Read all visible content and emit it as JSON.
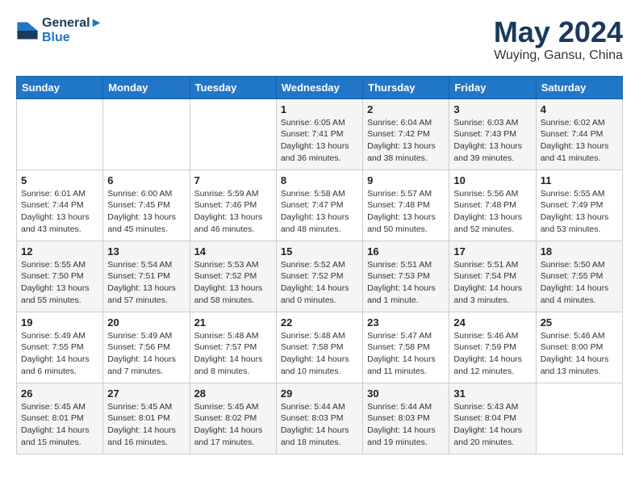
{
  "logo": {
    "line1": "General",
    "line2": "Blue"
  },
  "title": "May 2024",
  "subtitle": "Wuying, Gansu, China",
  "days_of_week": [
    "Sunday",
    "Monday",
    "Tuesday",
    "Wednesday",
    "Thursday",
    "Friday",
    "Saturday"
  ],
  "weeks": [
    [
      {
        "day": "",
        "sunrise": "",
        "sunset": "",
        "daylight": ""
      },
      {
        "day": "",
        "sunrise": "",
        "sunset": "",
        "daylight": ""
      },
      {
        "day": "",
        "sunrise": "",
        "sunset": "",
        "daylight": ""
      },
      {
        "day": "1",
        "sunrise": "Sunrise: 6:05 AM",
        "sunset": "Sunset: 7:41 PM",
        "daylight": "Daylight: 13 hours and 36 minutes."
      },
      {
        "day": "2",
        "sunrise": "Sunrise: 6:04 AM",
        "sunset": "Sunset: 7:42 PM",
        "daylight": "Daylight: 13 hours and 38 minutes."
      },
      {
        "day": "3",
        "sunrise": "Sunrise: 6:03 AM",
        "sunset": "Sunset: 7:43 PM",
        "daylight": "Daylight: 13 hours and 39 minutes."
      },
      {
        "day": "4",
        "sunrise": "Sunrise: 6:02 AM",
        "sunset": "Sunset: 7:44 PM",
        "daylight": "Daylight: 13 hours and 41 minutes."
      }
    ],
    [
      {
        "day": "5",
        "sunrise": "Sunrise: 6:01 AM",
        "sunset": "Sunset: 7:44 PM",
        "daylight": "Daylight: 13 hours and 43 minutes."
      },
      {
        "day": "6",
        "sunrise": "Sunrise: 6:00 AM",
        "sunset": "Sunset: 7:45 PM",
        "daylight": "Daylight: 13 hours and 45 minutes."
      },
      {
        "day": "7",
        "sunrise": "Sunrise: 5:59 AM",
        "sunset": "Sunset: 7:46 PM",
        "daylight": "Daylight: 13 hours and 46 minutes."
      },
      {
        "day": "8",
        "sunrise": "Sunrise: 5:58 AM",
        "sunset": "Sunset: 7:47 PM",
        "daylight": "Daylight: 13 hours and 48 minutes."
      },
      {
        "day": "9",
        "sunrise": "Sunrise: 5:57 AM",
        "sunset": "Sunset: 7:48 PM",
        "daylight": "Daylight: 13 hours and 50 minutes."
      },
      {
        "day": "10",
        "sunrise": "Sunrise: 5:56 AM",
        "sunset": "Sunset: 7:48 PM",
        "daylight": "Daylight: 13 hours and 52 minutes."
      },
      {
        "day": "11",
        "sunrise": "Sunrise: 5:55 AM",
        "sunset": "Sunset: 7:49 PM",
        "daylight": "Daylight: 13 hours and 53 minutes."
      }
    ],
    [
      {
        "day": "12",
        "sunrise": "Sunrise: 5:55 AM",
        "sunset": "Sunset: 7:50 PM",
        "daylight": "Daylight: 13 hours and 55 minutes."
      },
      {
        "day": "13",
        "sunrise": "Sunrise: 5:54 AM",
        "sunset": "Sunset: 7:51 PM",
        "daylight": "Daylight: 13 hours and 57 minutes."
      },
      {
        "day": "14",
        "sunrise": "Sunrise: 5:53 AM",
        "sunset": "Sunset: 7:52 PM",
        "daylight": "Daylight: 13 hours and 58 minutes."
      },
      {
        "day": "15",
        "sunrise": "Sunrise: 5:52 AM",
        "sunset": "Sunset: 7:52 PM",
        "daylight": "Daylight: 14 hours and 0 minutes."
      },
      {
        "day": "16",
        "sunrise": "Sunrise: 5:51 AM",
        "sunset": "Sunset: 7:53 PM",
        "daylight": "Daylight: 14 hours and 1 minute."
      },
      {
        "day": "17",
        "sunrise": "Sunrise: 5:51 AM",
        "sunset": "Sunset: 7:54 PM",
        "daylight": "Daylight: 14 hours and 3 minutes."
      },
      {
        "day": "18",
        "sunrise": "Sunrise: 5:50 AM",
        "sunset": "Sunset: 7:55 PM",
        "daylight": "Daylight: 14 hours and 4 minutes."
      }
    ],
    [
      {
        "day": "19",
        "sunrise": "Sunrise: 5:49 AM",
        "sunset": "Sunset: 7:55 PM",
        "daylight": "Daylight: 14 hours and 6 minutes."
      },
      {
        "day": "20",
        "sunrise": "Sunrise: 5:49 AM",
        "sunset": "Sunset: 7:56 PM",
        "daylight": "Daylight: 14 hours and 7 minutes."
      },
      {
        "day": "21",
        "sunrise": "Sunrise: 5:48 AM",
        "sunset": "Sunset: 7:57 PM",
        "daylight": "Daylight: 14 hours and 8 minutes."
      },
      {
        "day": "22",
        "sunrise": "Sunrise: 5:48 AM",
        "sunset": "Sunset: 7:58 PM",
        "daylight": "Daylight: 14 hours and 10 minutes."
      },
      {
        "day": "23",
        "sunrise": "Sunrise: 5:47 AM",
        "sunset": "Sunset: 7:58 PM",
        "daylight": "Daylight: 14 hours and 11 minutes."
      },
      {
        "day": "24",
        "sunrise": "Sunrise: 5:46 AM",
        "sunset": "Sunset: 7:59 PM",
        "daylight": "Daylight: 14 hours and 12 minutes."
      },
      {
        "day": "25",
        "sunrise": "Sunrise: 5:46 AM",
        "sunset": "Sunset: 8:00 PM",
        "daylight": "Daylight: 14 hours and 13 minutes."
      }
    ],
    [
      {
        "day": "26",
        "sunrise": "Sunrise: 5:45 AM",
        "sunset": "Sunset: 8:01 PM",
        "daylight": "Daylight: 14 hours and 15 minutes."
      },
      {
        "day": "27",
        "sunrise": "Sunrise: 5:45 AM",
        "sunset": "Sunset: 8:01 PM",
        "daylight": "Daylight: 14 hours and 16 minutes."
      },
      {
        "day": "28",
        "sunrise": "Sunrise: 5:45 AM",
        "sunset": "Sunset: 8:02 PM",
        "daylight": "Daylight: 14 hours and 17 minutes."
      },
      {
        "day": "29",
        "sunrise": "Sunrise: 5:44 AM",
        "sunset": "Sunset: 8:03 PM",
        "daylight": "Daylight: 14 hours and 18 minutes."
      },
      {
        "day": "30",
        "sunrise": "Sunrise: 5:44 AM",
        "sunset": "Sunset: 8:03 PM",
        "daylight": "Daylight: 14 hours and 19 minutes."
      },
      {
        "day": "31",
        "sunrise": "Sunrise: 5:43 AM",
        "sunset": "Sunset: 8:04 PM",
        "daylight": "Daylight: 14 hours and 20 minutes."
      },
      {
        "day": "",
        "sunrise": "",
        "sunset": "",
        "daylight": ""
      }
    ]
  ]
}
